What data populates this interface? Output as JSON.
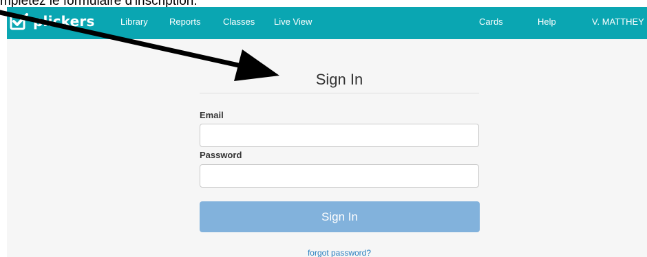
{
  "caption": "mplétez le formulaire d'inscription.",
  "colors": {
    "navbar": "#0aa6b2",
    "button": "#82b2dc",
    "link": "#2a7fbf"
  },
  "brand": {
    "name": "plickers",
    "icon": "plickers-checkbox-logo"
  },
  "nav": {
    "left": [
      "Library",
      "Reports",
      "Classes",
      "Live View"
    ],
    "right": [
      "Cards",
      "Help",
      "V. MATTHEY"
    ]
  },
  "form": {
    "title": "Sign In",
    "email_label": "Email",
    "email_value": "",
    "password_label": "Password",
    "password_value": "",
    "submit_label": "Sign In",
    "forgot_label": "forgot password?"
  },
  "annotation": {
    "icon": "arrow-icon"
  }
}
